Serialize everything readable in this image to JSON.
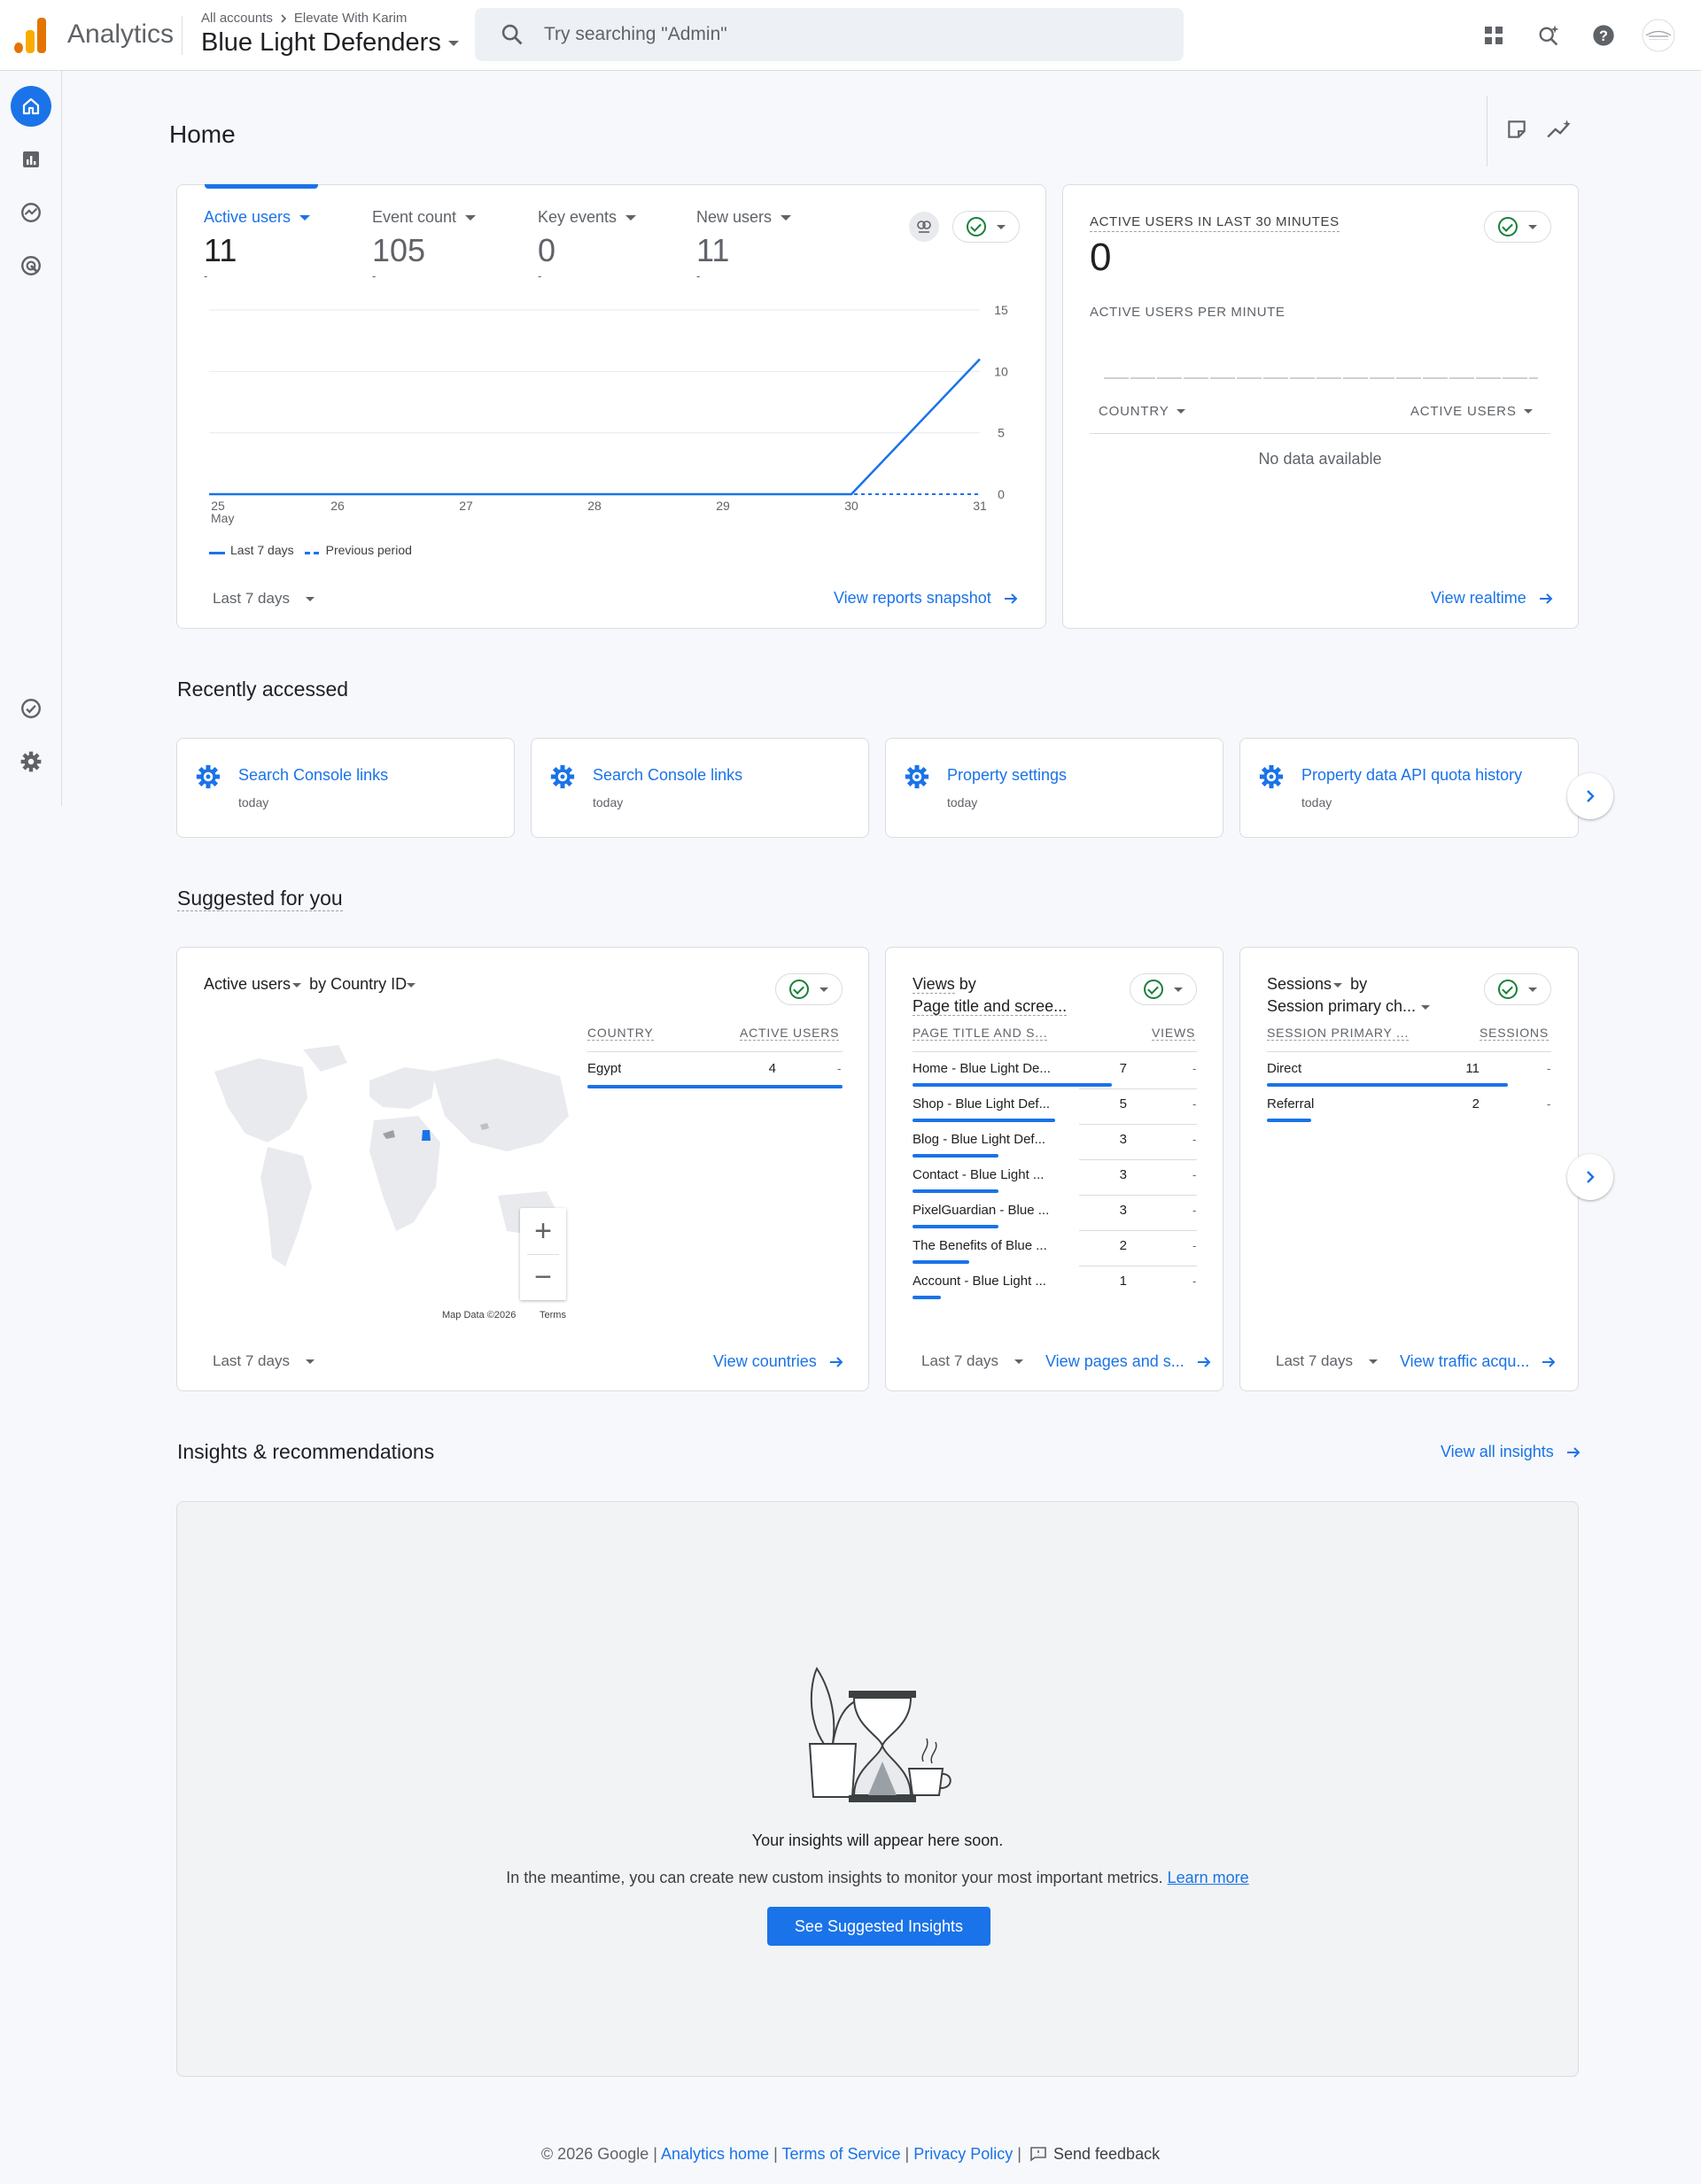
{
  "topbar": {
    "product": "Analytics",
    "breadcrumb_root": "All accounts",
    "breadcrumb_account": "Elevate With Karim",
    "property": "Blue Light Defenders",
    "search_placeholder": "Try searching \"Admin\""
  },
  "home": {
    "title": "Home"
  },
  "overview": {
    "metrics": [
      {
        "label": "Active users",
        "value": "11",
        "dash": "-"
      },
      {
        "label": "Event count",
        "value": "105",
        "dash": "-"
      },
      {
        "label": "Key events",
        "value": "0",
        "dash": "-"
      },
      {
        "label": "New users",
        "value": "11",
        "dash": "-"
      }
    ],
    "legend_current": "Last 7 days",
    "legend_previous": "Previous period",
    "date_range": "Last 7 days",
    "link": "View reports snapshot"
  },
  "chart_data": {
    "type": "line",
    "x": [
      "25 May",
      "26",
      "27",
      "28",
      "29",
      "30",
      "31"
    ],
    "series": [
      {
        "name": "Last 7 days",
        "values": [
          0,
          0,
          0,
          0,
          0,
          0,
          11
        ]
      },
      {
        "name": "Previous period",
        "values": [
          0,
          0,
          0,
          0,
          0,
          0,
          0
        ]
      }
    ],
    "x_tick_labels": [
      "25",
      "26",
      "27",
      "28",
      "29",
      "30",
      "31"
    ],
    "x_first_sublabel": "May",
    "y_ticks": [
      "15",
      "10",
      "5",
      "0"
    ],
    "ylim": [
      0,
      15
    ],
    "grid": true,
    "colors": {
      "series": "#1a73e8"
    }
  },
  "realtime": {
    "title": "ACTIVE USERS IN LAST 30 MINUTES",
    "value": "0",
    "per_minute": "ACTIVE USERS PER MINUTE",
    "col_country": "COUNTRY",
    "col_users": "ACTIVE USERS",
    "empty": "No data available",
    "link": "View realtime"
  },
  "recent": {
    "title": "Recently accessed",
    "items": [
      {
        "title": "Search Console links",
        "when": "today"
      },
      {
        "title": "Search Console links",
        "when": "today"
      },
      {
        "title": "Property settings",
        "when": "today"
      },
      {
        "title": "Property data API quota history",
        "when": "today"
      }
    ]
  },
  "suggested": {
    "title": "Suggested for you",
    "country_card": {
      "metric": "Active users",
      "by": "by",
      "dimension": "Country ID",
      "col_country": "COUNTRY",
      "col_users": "ACTIVE USERS",
      "rows": [
        {
          "name": "Egypt",
          "value": "4",
          "dash": "-",
          "share": 1.0
        }
      ],
      "map_attribution": "Map Data ©2026",
      "map_terms": "Terms",
      "zoom_in": "+",
      "zoom_out": "−",
      "date_range": "Last 7 days",
      "link": "View countries"
    },
    "pages_card": {
      "metric": "Views",
      "by": "by",
      "dimension": "Page title and scree...",
      "col_page": "PAGE TITLE AND S...",
      "col_views": "VIEWS",
      "rows": [
        {
          "name": "Home - Blue Light De...",
          "value": "7",
          "dash": "-",
          "share": 1.0
        },
        {
          "name": "Shop - Blue Light Def...",
          "value": "5",
          "dash": "-",
          "share": 0.714
        },
        {
          "name": "Blog - Blue Light Def...",
          "value": "3",
          "dash": "-",
          "share": 0.429
        },
        {
          "name": "Contact - Blue Light ...",
          "value": "3",
          "dash": "-",
          "share": 0.429
        },
        {
          "name": "PixelGuardian - Blue ...",
          "value": "3",
          "dash": "-",
          "share": 0.429
        },
        {
          "name": "The Benefits of Blue ...",
          "value": "2",
          "dash": "-",
          "share": 0.286
        },
        {
          "name": "Account - Blue Light ...",
          "value": "1",
          "dash": "-",
          "share": 0.143
        }
      ],
      "date_range": "Last 7 days",
      "link": "View pages and s..."
    },
    "sessions_card": {
      "metric": "Sessions",
      "by": "by",
      "dimension": "Session primary ch...",
      "col_channel": "SESSION PRIMARY ...",
      "col_sessions": "SESSIONS",
      "rows": [
        {
          "name": "Direct",
          "value": "11",
          "dash": "-",
          "share": 1.0
        },
        {
          "name": "Referral",
          "value": "2",
          "dash": "-",
          "share": 0.182
        }
      ],
      "date_range": "Last 7 days",
      "link": "View traffic acqu..."
    }
  },
  "insights": {
    "title": "Insights & recommendations",
    "view_all": "View all insights",
    "headline": "Your insights will appear here soon.",
    "body": "In the meantime, you can create new custom insights to monitor your most important metrics.",
    "learn_more": "Learn more",
    "button": "See Suggested Insights"
  },
  "footer": {
    "copyright": "© 2026 Google",
    "sep": "|",
    "analytics_home": "Analytics home",
    "terms": "Terms of Service",
    "privacy": "Privacy Policy",
    "feedback": "Send feedback"
  },
  "colors": {
    "accent": "#1a73e8",
    "success": "#188038",
    "logo_orange": "#f9ab00",
    "logo_dark": "#e37400"
  }
}
